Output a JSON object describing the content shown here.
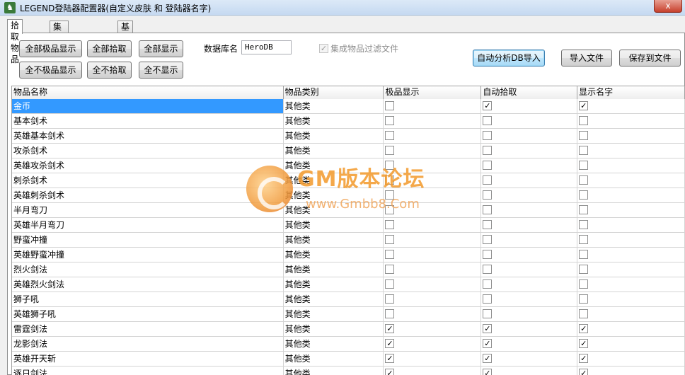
{
  "window": {
    "title": "LEGEND登陆器配置器(自定义皮肤 和 登陆器名字)",
    "close_label": "x"
  },
  "tabs": [
    {
      "label": "拾取物品",
      "active": true
    },
    {
      "label": "集成补丁(屏蔽)",
      "active": false
    },
    {
      "label": "基本信息",
      "active": false
    }
  ],
  "toolbar": {
    "all_quality_show": "全部极品显示",
    "all_pickup": "全部拾取",
    "all_show": "全部显示",
    "none_quality_show": "全不极品显示",
    "none_pickup": "全不拾取",
    "none_show": "全不显示",
    "db_label": "数据库名",
    "db_value": "HeroDB",
    "filter_label": "集成物品过滤文件",
    "auto_import": "自动分析DB导入",
    "import_file": "导入文件",
    "save_file": "保存到文件"
  },
  "grid": {
    "headers": [
      "物品名称",
      "物品类别",
      "极品显示",
      "自动拾取",
      "显示名字"
    ],
    "rows": [
      {
        "name": "金币",
        "category": "其他类",
        "quality": false,
        "pickup": true,
        "show_name": true
      },
      {
        "name": "基本剑术",
        "category": "其他类",
        "quality": false,
        "pickup": false,
        "show_name": false
      },
      {
        "name": "英雄基本剑术",
        "category": "其他类",
        "quality": false,
        "pickup": false,
        "show_name": false
      },
      {
        "name": "攻杀剑术",
        "category": "其他类",
        "quality": false,
        "pickup": false,
        "show_name": false
      },
      {
        "name": "英雄攻杀剑术",
        "category": "其他类",
        "quality": false,
        "pickup": false,
        "show_name": false
      },
      {
        "name": "刺杀剑术",
        "category": "其他类",
        "quality": false,
        "pickup": false,
        "show_name": false
      },
      {
        "name": "英雄刺杀剑术",
        "category": "其他类",
        "quality": false,
        "pickup": false,
        "show_name": false
      },
      {
        "name": "半月弯刀",
        "category": "其他类",
        "quality": false,
        "pickup": false,
        "show_name": false
      },
      {
        "name": "英雄半月弯刀",
        "category": "其他类",
        "quality": false,
        "pickup": false,
        "show_name": false
      },
      {
        "name": "野蛮冲撞",
        "category": "其他类",
        "quality": false,
        "pickup": false,
        "show_name": false
      },
      {
        "name": "英雄野蛮冲撞",
        "category": "其他类",
        "quality": false,
        "pickup": false,
        "show_name": false
      },
      {
        "name": "烈火剑法",
        "category": "其他类",
        "quality": false,
        "pickup": false,
        "show_name": false
      },
      {
        "name": "英雄烈火剑法",
        "category": "其他类",
        "quality": false,
        "pickup": false,
        "show_name": false
      },
      {
        "name": "狮子吼",
        "category": "其他类",
        "quality": false,
        "pickup": false,
        "show_name": false
      },
      {
        "name": "英雄狮子吼",
        "category": "其他类",
        "quality": false,
        "pickup": false,
        "show_name": false
      },
      {
        "name": "雷霆剑法",
        "category": "其他类",
        "quality": true,
        "pickup": true,
        "show_name": true
      },
      {
        "name": "龙影剑法",
        "category": "其他类",
        "quality": true,
        "pickup": true,
        "show_name": true
      },
      {
        "name": "英雄开天斩",
        "category": "其他类",
        "quality": true,
        "pickup": true,
        "show_name": true
      },
      {
        "name": "逐日剑法",
        "category": "其他类",
        "quality": true,
        "pickup": true,
        "show_name": true
      }
    ]
  },
  "watermark": {
    "title": "GM版本论坛",
    "url": "www.Gmbb8.Com"
  }
}
